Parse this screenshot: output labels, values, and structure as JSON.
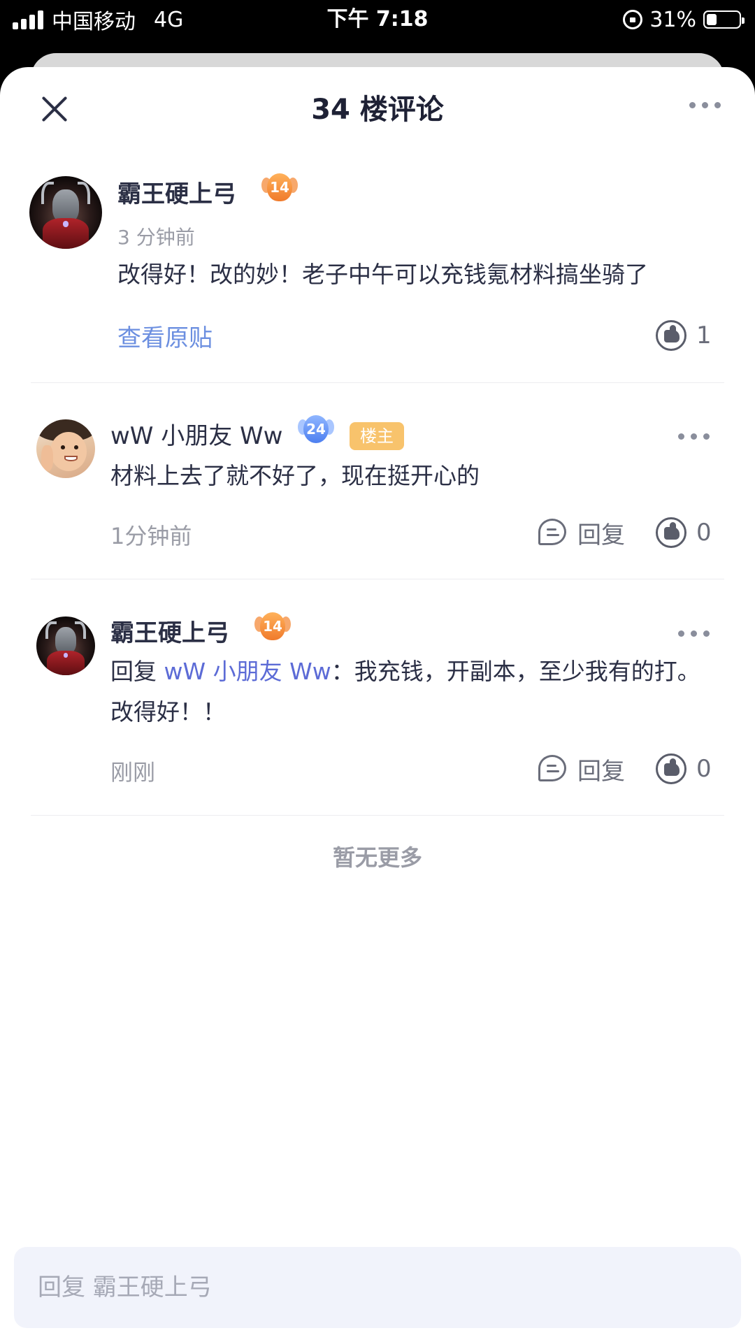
{
  "status_bar": {
    "carrier": "中国移动",
    "network": "4G",
    "time": "下午 7:18",
    "battery_percent": "31%",
    "battery_level": 0.31
  },
  "header": {
    "title": "34 楼评论"
  },
  "main_comment": {
    "author": "霸王硬上弓",
    "level": "14",
    "time": "3 分钟前",
    "text": "改得好！改的妙！老子中午可以充钱氪材料搞坐骑了",
    "view_original": "查看原贴",
    "like_count": "1"
  },
  "replies": [
    {
      "author": "wW 小朋友 Ww",
      "level": "24",
      "owner_tag": "楼主",
      "text": "材料上去了就不好了，现在挺开心的",
      "time": "1分钟前",
      "reply_label": "回复",
      "like_count": "0"
    },
    {
      "author": "霸王硬上弓",
      "level": "14",
      "reply_prefix": "回复 ",
      "mention": "wW 小朋友 Ww",
      "text_after": "：我充钱，开副本，至少我有的打。改得好！！",
      "time": "刚刚",
      "reply_label": "回复",
      "like_count": "0"
    }
  ],
  "no_more": "暂无更多",
  "reply_input": {
    "placeholder": "回复 霸王硬上弓"
  },
  "colors": {
    "accent_link": "#6c8fe0",
    "mention": "#5c6bd6",
    "owner_tag": "#f8c36c"
  }
}
